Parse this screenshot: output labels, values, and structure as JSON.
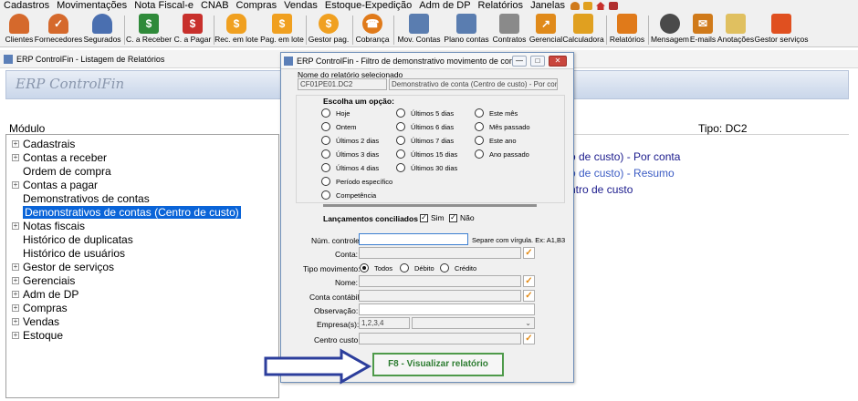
{
  "menu": [
    "Cadastros",
    "Movimentações",
    "Nota Fiscal-e",
    "CNAB",
    "Compras",
    "Vendas",
    "Estoque-Expedição",
    "Adm de DP",
    "Relatórios",
    "Janelas"
  ],
  "toolbar": [
    {
      "label": "Clientes",
      "icon": "clientes-icon",
      "color": "#d5692c"
    },
    {
      "label": "Fornecedores",
      "icon": "fornecedores-icon",
      "color": "#d5692c"
    },
    {
      "label": "Segurados",
      "icon": "segurados-icon",
      "color": "#4a6fb0"
    },
    {
      "label": "C. a Receber",
      "icon": "receivable-icon",
      "color": "#2f8a3a"
    },
    {
      "label": "C. a Pagar",
      "icon": "payable-icon",
      "color": "#c8302c"
    },
    {
      "label": "Rec. em lote",
      "icon": "money-bag-icon",
      "color": "#f0a020"
    },
    {
      "label": "Pag. em lote",
      "icon": "dollar-icon",
      "color": "#f0a020"
    },
    {
      "label": "Gestor pag.",
      "icon": "coin-icon",
      "color": "#f0a020"
    },
    {
      "label": "Cobrança",
      "icon": "phone-icon",
      "color": "#e07a1a"
    },
    {
      "label": "Mov. Contas",
      "icon": "calendar-icon",
      "color": "#5a7db0"
    },
    {
      "label": "Plano contas",
      "icon": "chart-icon",
      "color": "#5a7db0"
    },
    {
      "label": "Contratos",
      "icon": "contract-icon",
      "color": "#8a8a8a"
    },
    {
      "label": "Gerencial",
      "icon": "growth-icon",
      "color": "#e08a1a"
    },
    {
      "label": "Calculadora",
      "icon": "calculator-icon",
      "color": "#e0a020"
    },
    {
      "label": "Relatórios",
      "icon": "reports-icon",
      "color": "#e07a1a"
    },
    {
      "label": "Mensagem",
      "icon": "message-icon",
      "color": "#4a4a4a"
    },
    {
      "label": "E-mails",
      "icon": "email-icon",
      "color": "#d07a1a"
    },
    {
      "label": "Anotações",
      "icon": "notes-icon",
      "color": "#e0c060"
    },
    {
      "label": "Gestor serviços",
      "icon": "services-icon",
      "color": "#e05020"
    }
  ],
  "main_window": {
    "title": "ERP ControlFin - Listagem de Relatórios",
    "banner": "ERP ControlFin",
    "modulo_header": "Módulo",
    "tipo_header": "Tipo: DC2",
    "tree": [
      {
        "label": "Cadastrais",
        "expander": true
      },
      {
        "label": "Contas a receber",
        "expander": true
      },
      {
        "label": "Ordem de compra",
        "expander": false
      },
      {
        "label": "Contas a pagar",
        "expander": true
      },
      {
        "label": "Demonstrativos de contas",
        "expander": false
      },
      {
        "label": "Demonstrativos de contas (Centro de custo)",
        "expander": false,
        "selected": true
      },
      {
        "label": "Notas fiscais",
        "expander": true
      },
      {
        "label": "Histórico de duplicatas",
        "expander": false
      },
      {
        "label": "Histórico de usuários",
        "expander": false
      },
      {
        "label": "Gestor de serviços",
        "expander": true
      },
      {
        "label": "Gerenciais",
        "expander": true
      },
      {
        "label": "Adm de DP",
        "expander": true
      },
      {
        "label": "Compras",
        "expander": true
      },
      {
        "label": "Vendas",
        "expander": true
      },
      {
        "label": "Estoque",
        "expander": true
      }
    ],
    "right_items": [
      {
        "text": "o de custo) - Por conta",
        "color": "#1a1a8c"
      },
      {
        "text": "o de custo) - Resumo",
        "color": "#3c5cc4"
      },
      {
        "text": "ntro de custo",
        "color": "#1a1a8c"
      }
    ]
  },
  "dialog": {
    "title": "ERP ControlFin - Filtro de demonstrativo movimento de conta",
    "report_name_label": "Nome do relatório selecionado",
    "report_code": "CF01PE01.DC2",
    "report_name": "Demonstrativo de conta (Centro de custo) - Por conta",
    "choose_label": "Escolha um opção:",
    "periods": [
      "Hoje",
      "Ontem",
      "Últimos 2 dias",
      "Últimos 3 dias",
      "Últimos 4 dias",
      "Período específico",
      "Competência",
      "Últimos 5 dias",
      "Últimos 6 dias",
      "Últimos 7 dias",
      "Últimos 15 dias",
      "Últimos 30 dias",
      "Este mês",
      "Mês passado",
      "Este ano",
      "Ano passado"
    ],
    "conciliados_label": "Lançamentos conciliados",
    "sim_label": "Sim",
    "nao_label": "Não",
    "num_controle_label": "Núm. controle:",
    "num_controle_value": "",
    "num_controle_hint": "Separe com vírgula. Ex: A1,B3",
    "conta_label": "Conta:",
    "tipo_mov_label": "Tipo movimento:",
    "tipo_options": [
      "Todos",
      "Débito",
      "Crédito"
    ],
    "nome_label": "Nome:",
    "conta_contabil_label": "Conta contábil:",
    "observacao_label": "Observação:",
    "empresas_label": "Empresa(s):",
    "empresas_value": "1,2,3,4",
    "centro_custo_label": "Centro custo:",
    "f8_button": "F8 - Visualizar relatório"
  },
  "colors": {
    "accent_blue": "#0a64d8",
    "f8_green": "#2e7d32",
    "arrow_blue": "#2c3e9c"
  }
}
